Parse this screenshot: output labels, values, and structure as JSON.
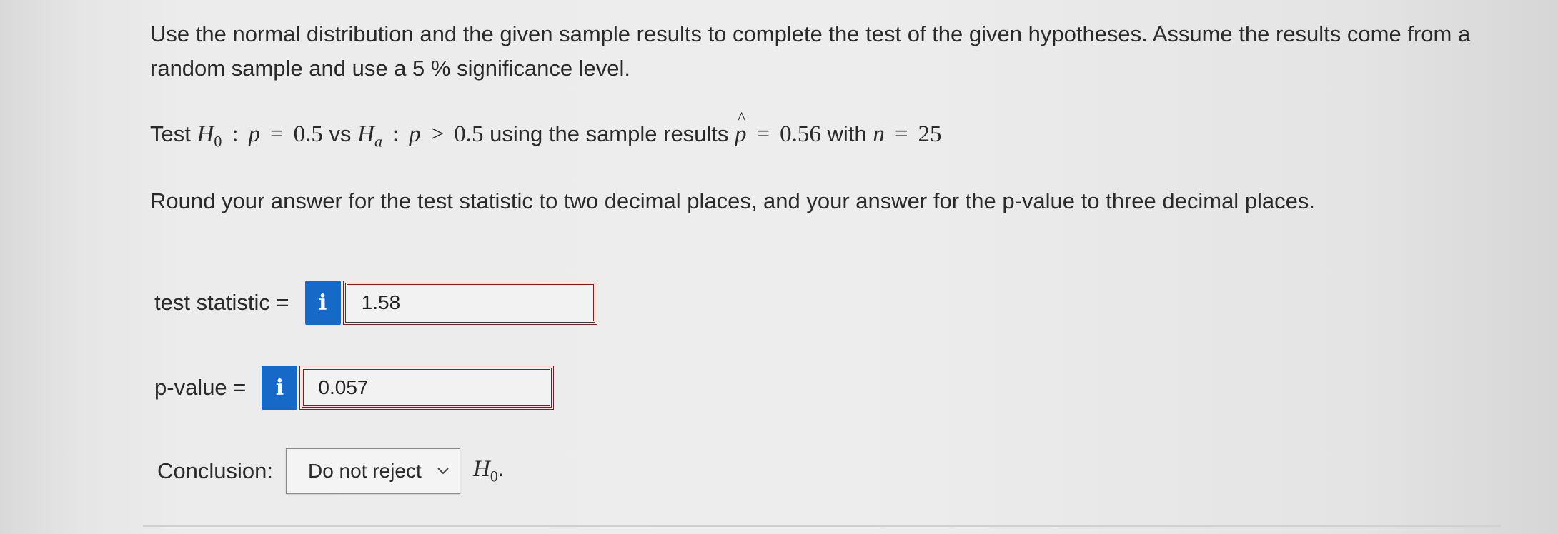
{
  "question": {
    "intro": "Use the normal distribution and the given sample results to complete the test of the given hypotheses. Assume the results come from a random sample and use a 5 % significance level.",
    "test": {
      "prefix": "Test",
      "h0_sym": "H",
      "h0_sub": "0",
      "colon": ":",
      "p": "p",
      "eq": "=",
      "null_value": "0.5",
      "vs": "vs",
      "ha_sym": "H",
      "ha_sub": "a",
      "gt": ">",
      "alt_value": "0.5",
      "sample_text": "using the sample results",
      "phat_sym": "p",
      "phat_value": "0.56",
      "with_text": "with",
      "n_sym": "n",
      "n_value": "25"
    },
    "rounding": "Round your answer for the test statistic to two decimal places, and your answer for the p-value to three decimal places."
  },
  "answers": {
    "test_statistic": {
      "label": "test statistic =",
      "info": "i",
      "value": "1.58"
    },
    "p_value": {
      "label": "p-value =",
      "info": "i",
      "value": "0.057"
    }
  },
  "conclusion": {
    "label": "Conclusion:",
    "selected": "Do not reject",
    "tail_sym": "H",
    "tail_sub": "0",
    "tail_punct": "."
  },
  "colors": {
    "info_button": "#1769c8",
    "answer_border": "#7a1f1f"
  },
  "icons": {
    "info": "info-icon",
    "dropdown": "chevron-down-icon"
  }
}
